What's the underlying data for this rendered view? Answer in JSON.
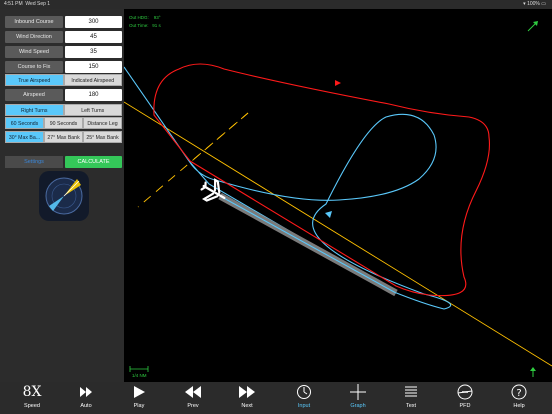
{
  "status": {
    "time": "4:51 PM",
    "date": "Wed Sep 1",
    "battery": "100%"
  },
  "inputs": [
    {
      "label": "Inbound Course",
      "value": "300"
    },
    {
      "label": "Wind Direction",
      "value": "45"
    },
    {
      "label": "Wind Speed",
      "value": "35"
    },
    {
      "label": "Course to Fix",
      "value": "150"
    }
  ],
  "airspeed_toggle": {
    "true_label": "True Airspeed",
    "indicated_label": "Indicated Airspeed",
    "selected": "true"
  },
  "airspeed": {
    "label": "Airspeed",
    "value": "180"
  },
  "turns": {
    "right_label": "Right Turns",
    "left_label": "Left Turns",
    "selected": "right"
  },
  "leg": {
    "opt1": "60 Seconds",
    "opt2": "90 Seconds",
    "opt3": "Distance Leg",
    "selected": "60 Seconds"
  },
  "bank": {
    "opt1": "30° Max Ba...",
    "opt2": "27° Max Bank",
    "opt3": "25° Max Bank",
    "selected": "30° Max Bank"
  },
  "buttons": {
    "settings": "Settings",
    "calculate": "CALCULATE"
  },
  "map_info": {
    "hdg_label": "Out HDG:",
    "hdg_value": "93°",
    "time_label": "Out Time:",
    "time_value": "91 s",
    "scale": "1/4 NM"
  },
  "tabs": [
    {
      "label": "Speed"
    },
    {
      "label": "Auto"
    },
    {
      "label": "Play"
    },
    {
      "label": "Prev"
    },
    {
      "label": "Next"
    },
    {
      "label": "Input"
    },
    {
      "label": "Graph"
    },
    {
      "label": "Text"
    },
    {
      "label": "PFD"
    },
    {
      "label": "Help"
    }
  ],
  "colors": {
    "accent": "#5ac8fa",
    "calculate": "#34c759",
    "wind": "#ff0000",
    "nowind": "#5ac8fa",
    "course": "#ffc000"
  }
}
